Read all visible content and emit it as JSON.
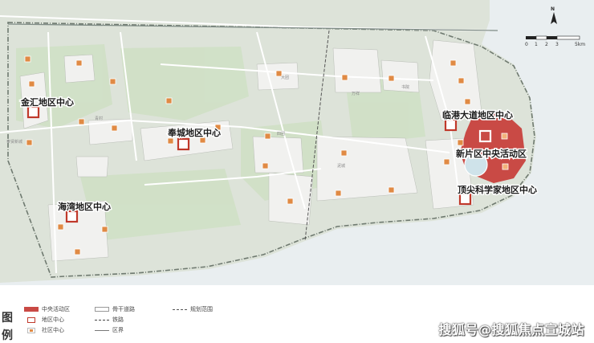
{
  "map": {
    "colors": {
      "land": "#dde3d9",
      "sea": "#e9eef0",
      "green": "#cfe0c4",
      "built": "#f1f1ef",
      "core": "#c94a45",
      "community": "#e08a44",
      "center_box": "#c0392b"
    },
    "center_labels": {
      "jinhui": "金汇地区中心",
      "fengcheng": "奉城地区中心",
      "haiwan": "海湾地区中心",
      "lingang": "临港大道地区中心",
      "xinpian": "新片区中央活动区",
      "dingjian": "顶尖科学家地区中心"
    },
    "minor_labels": {
      "a": "青村",
      "b": "四团",
      "c": "万祥",
      "d": "书院",
      "e": "泥城",
      "f": "大团",
      "g": "奉贤新城"
    },
    "north": {
      "label": "N"
    },
    "scale": {
      "ticks": [
        "0",
        "1",
        "2",
        "3",
        "5km"
      ]
    }
  },
  "legend": {
    "title_top": "图",
    "title_bottom": "例",
    "items": [
      {
        "label": "中央活动区",
        "icon": "red-fill-swatch"
      },
      {
        "label": "地区中心",
        "icon": "red-outline-square"
      },
      {
        "label": "社区中心",
        "icon": "orange-dot-square"
      },
      {
        "label": "骨干道路",
        "icon": "road-swatch"
      },
      {
        "label": "铁路",
        "icon": "rail-swatch"
      },
      {
        "label": "区界",
        "icon": "boundary-swatch"
      },
      {
        "label": "规划范围",
        "icon": "plan-boundary-swatch"
      }
    ]
  },
  "watermark": "搜狐号@搜狐焦点宣城站"
}
